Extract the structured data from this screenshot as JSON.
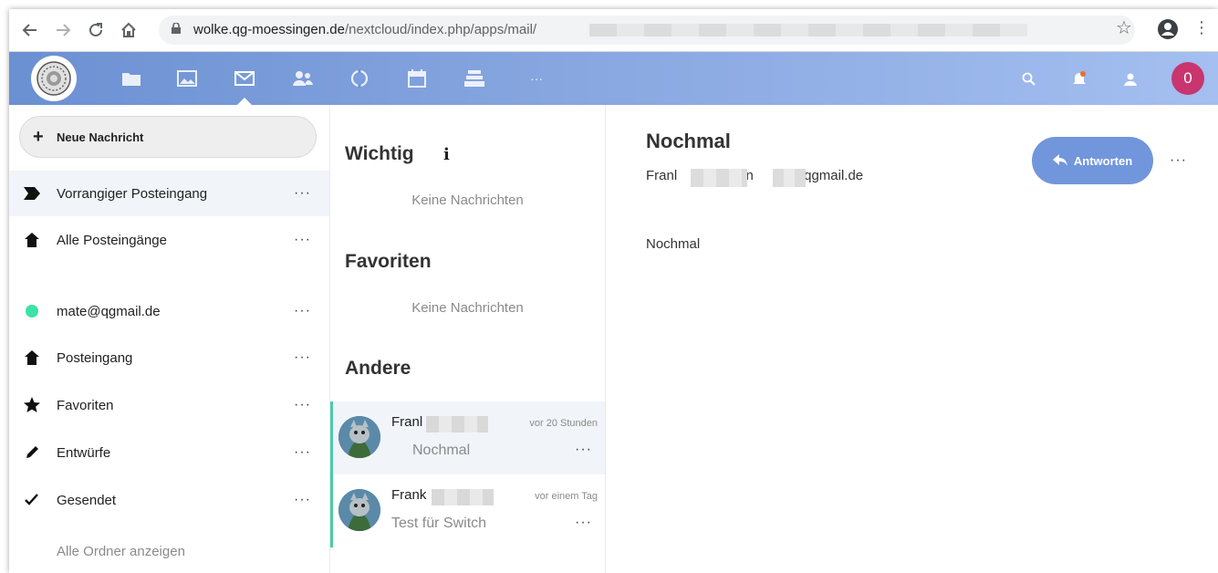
{
  "browser": {
    "url_domain": "wolke.qg-moessingen.de",
    "url_path": "/nextcloud/index.php/apps/mail/",
    "icons": [
      "back-icon",
      "forward-icon",
      "reload-icon",
      "home-icon",
      "lock-icon",
      "star-icon",
      "account-icon",
      "kebab-icon"
    ]
  },
  "header": {
    "apps": [
      "files-icon",
      "photos-icon",
      "mail-icon",
      "contacts-icon",
      "activity-icon",
      "calendar-icon",
      "deck-icon",
      "more-apps-icon"
    ],
    "more_apps_label": "···",
    "active_app": "mail",
    "user_initial": "0",
    "colors": {
      "gradient_start": "#6b90d2",
      "gradient_end": "#a4bff0",
      "avatar": "#c9356e"
    }
  },
  "sidebar": {
    "new_message_label": "Neue Nachricht",
    "more_label": "···",
    "items": [
      {
        "label": "Vorrangiger Posteingang",
        "icon": "priority-icon",
        "selected": true
      },
      {
        "label": "Alle Posteingänge",
        "icon": "inbox-icon"
      },
      {
        "label": "mate@qgmail.de",
        "icon": "account-dot-icon",
        "color": "#3be3a4"
      },
      {
        "label": "Posteingang",
        "icon": "inbox-icon"
      },
      {
        "label": "Favoriten",
        "icon": "star-icon"
      },
      {
        "label": "Entwürfe",
        "icon": "pencil-icon"
      },
      {
        "label": "Gesendet",
        "icon": "check-icon"
      }
    ],
    "show_all_label": "Alle Ordner anzeigen"
  },
  "message_list": {
    "sections": [
      {
        "title": "Wichtig",
        "empty_label": "Keine Nachrichten",
        "has_info": true
      },
      {
        "title": "Favoriten",
        "empty_label": "Keine Nachrichten"
      },
      {
        "title": "Andere"
      }
    ],
    "info_label": "i",
    "more_label": "···",
    "envelopes": [
      {
        "from": "Franl",
        "time": "vor 20 Stunden",
        "subject": "Nochmal",
        "selected": true
      },
      {
        "from": "Frank",
        "time": "vor einem Tag",
        "subject": "Test für Switch",
        "selected": false
      }
    ],
    "accent_color": "#4ecaa6"
  },
  "message_view": {
    "subject": "Nochmal",
    "from": "Franl",
    "to_label": "an",
    "to_domain": "@qgmail.de",
    "body": "Nochmal",
    "reply_label": "Antworten",
    "more_label": "···",
    "reply_color": "#7196db"
  }
}
